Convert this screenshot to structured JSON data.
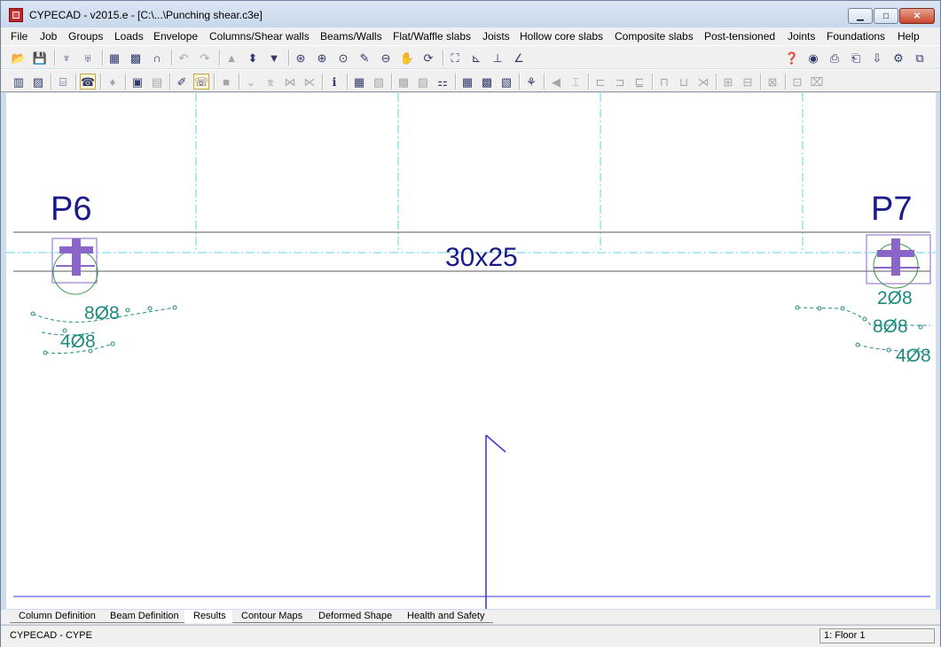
{
  "window": {
    "title": "CYPECAD - v2015.e - [C:\\...\\Punching shear.c3e]",
    "min_glyph": "▁",
    "max_glyph": "□",
    "close_glyph": "✕"
  },
  "menu": [
    "File",
    "Job",
    "Groups",
    "Loads",
    "Envelope",
    "Columns/Shear walls",
    "Beams/Walls",
    "Flat/Waffle slabs",
    "Joists",
    "Hollow core slabs",
    "Composite slabs",
    "Post-tensioned",
    "Joints",
    "Foundations",
    "Help"
  ],
  "toolbar1": [
    {
      "name": "open-icon",
      "glyph": "📂"
    },
    {
      "name": "save-icon",
      "glyph": "💾"
    },
    {
      "name": "sep"
    },
    {
      "name": "groups-icon",
      "glyph": "♆"
    },
    {
      "name": "envelope-icon",
      "glyph": "♅"
    },
    {
      "name": "sep"
    },
    {
      "name": "dxf-template-icon",
      "glyph": "▦"
    },
    {
      "name": "dwg-template-icon",
      "glyph": "▩"
    },
    {
      "name": "magnet-icon",
      "glyph": "∩"
    },
    {
      "name": "sep"
    },
    {
      "name": "undo-icon",
      "glyph": "↶",
      "dim": true
    },
    {
      "name": "redo-icon",
      "glyph": "↷",
      "dim": true
    },
    {
      "name": "sep"
    },
    {
      "name": "floor-up-icon",
      "glyph": "▲",
      "dim": true
    },
    {
      "name": "floor-select-icon",
      "glyph": "⬍"
    },
    {
      "name": "floor-down-icon",
      "glyph": "▼"
    },
    {
      "name": "sep"
    },
    {
      "name": "zoom-select-icon",
      "glyph": "⊛"
    },
    {
      "name": "zoom-all-icon",
      "glyph": "⊕"
    },
    {
      "name": "zoom-window-icon",
      "glyph": "⊙"
    },
    {
      "name": "pencil-icon",
      "glyph": "✎"
    },
    {
      "name": "zoom-out-icon",
      "glyph": "⊖"
    },
    {
      "name": "pan-hand-icon",
      "glyph": "✋"
    },
    {
      "name": "redraw-icon",
      "glyph": "⟳"
    },
    {
      "name": "sep"
    },
    {
      "name": "view-3d-icon",
      "glyph": "⛶"
    },
    {
      "name": "axes-icon",
      "glyph": "⊾"
    },
    {
      "name": "axes-2-icon",
      "glyph": "⊥"
    },
    {
      "name": "angle-icon",
      "glyph": "∠"
    }
  ],
  "toolbar1_right": [
    {
      "name": "help-icon",
      "glyph": "❓"
    },
    {
      "name": "web-icon",
      "glyph": "◉"
    },
    {
      "name": "print-icon",
      "glyph": "⎙"
    },
    {
      "name": "print-preview-icon",
      "glyph": "⎗"
    },
    {
      "name": "export-icon",
      "glyph": "⇩"
    },
    {
      "name": "settings-icon",
      "glyph": "⚙"
    },
    {
      "name": "window-icon",
      "glyph": "⧉"
    }
  ],
  "toolbar2": [
    {
      "name": "column-check-icon",
      "glyph": "▥"
    },
    {
      "name": "wall-icon",
      "glyph": "▨"
    },
    {
      "name": "sep"
    },
    {
      "name": "stairs-icon",
      "glyph": "⌸"
    },
    {
      "name": "sep"
    },
    {
      "name": "punching-shear-icon",
      "glyph": "☎",
      "pressed": true
    },
    {
      "name": "sep"
    },
    {
      "name": "drop-icon",
      "glyph": "♦",
      "dim": true
    },
    {
      "name": "sep"
    },
    {
      "name": "box-icon",
      "glyph": "▣"
    },
    {
      "name": "box-2-icon",
      "glyph": "▤",
      "dim": true
    },
    {
      "name": "sep"
    },
    {
      "name": "edit-rebar-icon",
      "glyph": "✐"
    },
    {
      "name": "punching-results-icon",
      "glyph": "☏",
      "pressed": true
    },
    {
      "name": "sep"
    },
    {
      "name": "panel-icon",
      "glyph": "■",
      "dim": true
    },
    {
      "name": "sep"
    },
    {
      "name": "beam-1-icon",
      "glyph": "⌄",
      "dim": true
    },
    {
      "name": "beam-2-icon",
      "glyph": "⌆",
      "dim": true
    },
    {
      "name": "beam-3-icon",
      "glyph": "⋈",
      "dim": true
    },
    {
      "name": "beam-4-icon",
      "glyph": "⋉",
      "dim": true
    },
    {
      "name": "sep"
    },
    {
      "name": "info-icon",
      "glyph": "ℹ"
    },
    {
      "name": "sep"
    },
    {
      "name": "rebar-1-icon",
      "glyph": "▦"
    },
    {
      "name": "rebar-2-icon",
      "glyph": "▧",
      "dim": true
    },
    {
      "name": "sep"
    },
    {
      "name": "rebar-3-icon",
      "glyph": "▩",
      "dim": true
    },
    {
      "name": "rebar-4-icon",
      "glyph": "▨",
      "dim": true
    },
    {
      "name": "rebar-5-icon",
      "glyph": "⚏"
    },
    {
      "name": "sep"
    },
    {
      "name": "grid-1-icon",
      "glyph": "▦"
    },
    {
      "name": "grid-2-icon",
      "glyph": "▩"
    },
    {
      "name": "grid-3-icon",
      "glyph": "▧"
    },
    {
      "name": "sep"
    },
    {
      "name": "joint-icon",
      "glyph": "⚘"
    },
    {
      "name": "sep"
    },
    {
      "name": "dim-1-icon",
      "glyph": "◀",
      "dim": true
    },
    {
      "name": "dim-2-icon",
      "glyph": "⌶",
      "dim": true
    },
    {
      "name": "sep"
    },
    {
      "name": "dim-3-icon",
      "glyph": "⊏",
      "dim": true
    },
    {
      "name": "dim-4-icon",
      "glyph": "⊐",
      "dim": true
    },
    {
      "name": "dim-5-icon",
      "glyph": "⊑",
      "dim": true
    },
    {
      "name": "sep"
    },
    {
      "name": "dim-6-icon",
      "glyph": "⊓",
      "dim": true
    },
    {
      "name": "dim-7-icon",
      "glyph": "⊔",
      "dim": true
    },
    {
      "name": "dim-8-icon",
      "glyph": "⋊",
      "dim": true
    },
    {
      "name": "sep"
    },
    {
      "name": "dim-9-icon",
      "glyph": "⊞",
      "dim": true
    },
    {
      "name": "dim-10-icon",
      "glyph": "⊟",
      "dim": true
    },
    {
      "name": "sep"
    },
    {
      "name": "dim-11-icon",
      "glyph": "⊠",
      "dim": true
    },
    {
      "name": "sep"
    },
    {
      "name": "dim-12-icon",
      "glyph": "⊡",
      "dim": true
    },
    {
      "name": "dim-13-icon",
      "glyph": "⌧",
      "dim": true
    }
  ],
  "drawing": {
    "column_left_label": "P6",
    "column_right_label": "P7",
    "beam_label": "30x25",
    "left_rebar_1": "8Ø8",
    "left_rebar_2": "4Ø8",
    "right_rebar_1": "2Ø8",
    "right_rebar_2": "8Ø8",
    "right_rebar_3": "4Ø8"
  },
  "tabs": [
    {
      "label": "Column Definition",
      "active": false
    },
    {
      "label": "Beam Definition",
      "active": false
    },
    {
      "label": "Results",
      "active": true
    },
    {
      "label": "Contour Maps",
      "active": false
    },
    {
      "label": "Deformed Shape",
      "active": false
    },
    {
      "label": "Health and Safety",
      "active": false
    }
  ],
  "status": {
    "left": "CYPECAD - CYPE",
    "right": "1: Floor 1"
  },
  "colors": {
    "label_blue": "#1a1a8c",
    "rebar_teal": "#1f8a82",
    "axis_cyan": "#5fd6e0",
    "column_purple": "#8a66c8",
    "circle_green": "#2f9a3f",
    "line_blue": "#3a32d0"
  }
}
